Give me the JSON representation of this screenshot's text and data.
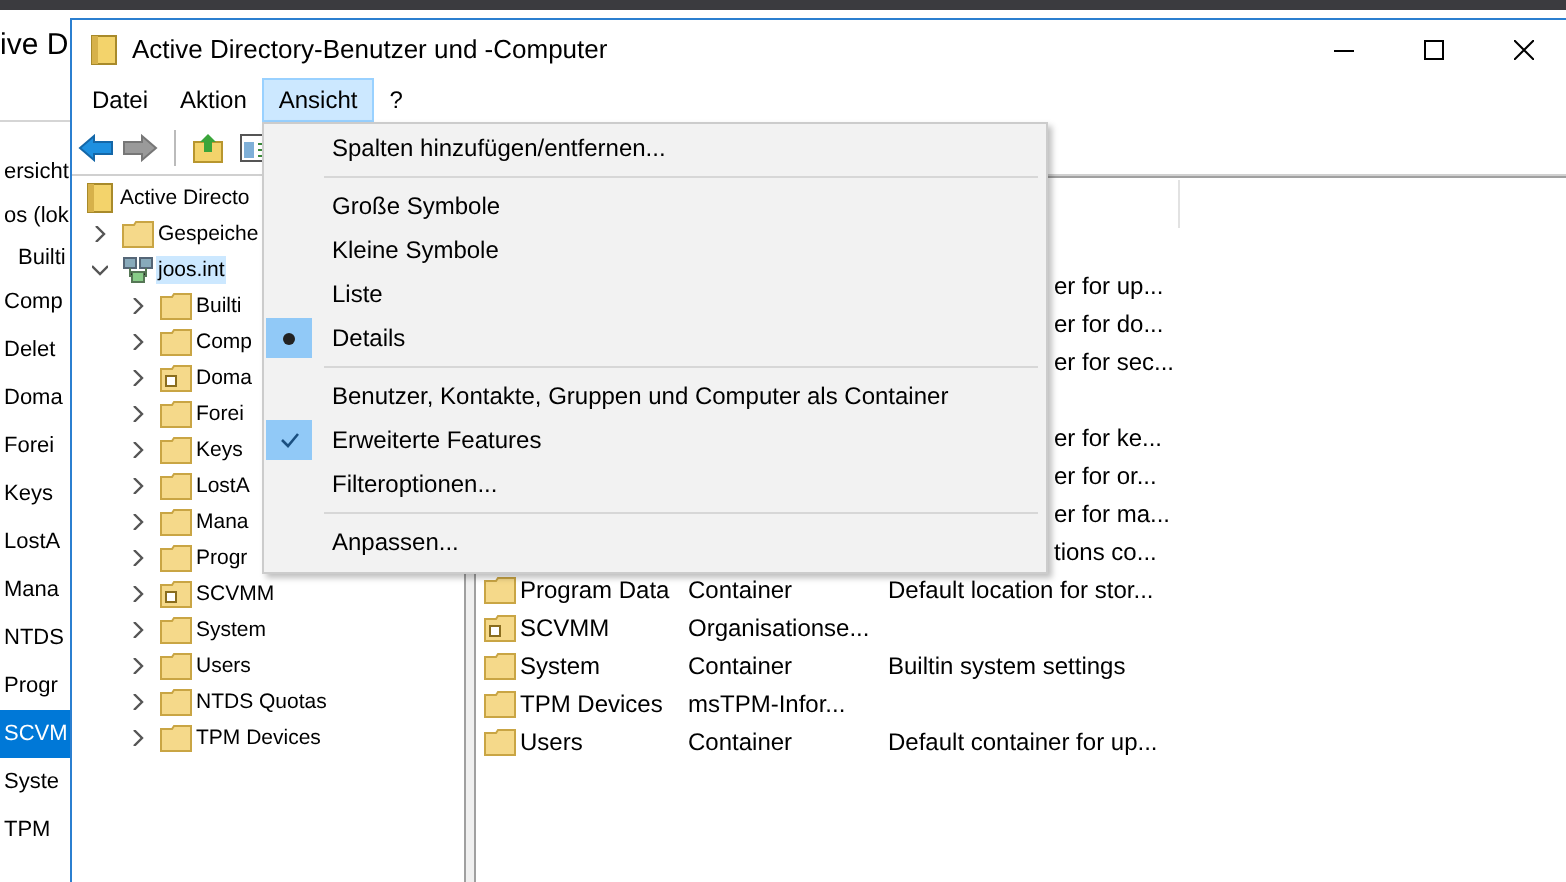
{
  "background_window": {
    "title": "ive D",
    "items": [
      {
        "label": "ersicht",
        "selected": false
      },
      {
        "label": "os (lok",
        "selected": false
      },
      {
        "label": "Builti",
        "selected": false
      },
      {
        "label": "Comp",
        "selected": false
      },
      {
        "label": "Delet",
        "selected": false
      },
      {
        "label": "Doma",
        "selected": false
      },
      {
        "label": "Forei",
        "selected": false
      },
      {
        "label": "Keys",
        "selected": false
      },
      {
        "label": "LostA",
        "selected": false
      },
      {
        "label": "Mana",
        "selected": false
      },
      {
        "label": "NTDS",
        "selected": false
      },
      {
        "label": "Progr",
        "selected": false
      },
      {
        "label": "SCVM",
        "selected": true
      },
      {
        "label": "Syste",
        "selected": false
      },
      {
        "label": "TPM",
        "selected": false
      }
    ]
  },
  "window": {
    "title": "Active Directory-Benutzer und -Computer"
  },
  "menu_bar": [
    {
      "label": "Datei",
      "selected": false
    },
    {
      "label": "Aktion",
      "selected": false
    },
    {
      "label": "Ansicht",
      "selected": true
    },
    {
      "label": "?",
      "selected": false
    }
  ],
  "tree": [
    {
      "label": "Active Directo",
      "kind": "snapin",
      "selected": false,
      "children": [
        {
          "label": "Gespeiche",
          "kind": "folder",
          "expanded": false,
          "selected": false
        },
        {
          "label": "joos.int",
          "kind": "domain",
          "expanded": true,
          "selected": true,
          "children": [
            {
              "label": "Builti",
              "kind": "folder",
              "expanded": false,
              "selected": false
            },
            {
              "label": "Comp",
              "kind": "folder",
              "expanded": false,
              "selected": false
            },
            {
              "label": "Doma",
              "kind": "ou",
              "expanded": false,
              "selected": false
            },
            {
              "label": "Forei",
              "kind": "folder",
              "expanded": false,
              "selected": false
            },
            {
              "label": "Keys",
              "kind": "folder",
              "expanded": false,
              "selected": false
            },
            {
              "label": "LostA",
              "kind": "folder",
              "expanded": false,
              "selected": false
            },
            {
              "label": "Mana",
              "kind": "folder",
              "expanded": false,
              "selected": false
            },
            {
              "label": "Progr",
              "kind": "folder",
              "expanded": false,
              "selected": false
            },
            {
              "label": "SCVMM",
              "kind": "ou",
              "expanded": false,
              "selected": false
            },
            {
              "label": "System",
              "kind": "folder",
              "expanded": false,
              "selected": false
            },
            {
              "label": "Users",
              "kind": "folder",
              "expanded": false,
              "selected": false
            },
            {
              "label": "NTDS Quotas",
              "kind": "folder",
              "expanded": false,
              "selected": false
            },
            {
              "label": "TPM Devices",
              "kind": "folder",
              "expanded": false,
              "selected": false
            }
          ]
        }
      ]
    }
  ],
  "list": {
    "rows": [
      {
        "kind": "partial",
        "column_3": "er for up..."
      },
      {
        "kind": "partial",
        "column_3": "er for do..."
      },
      {
        "kind": "partial",
        "column_3": "er for sec..."
      },
      {
        "kind": "blank"
      },
      {
        "kind": "partial",
        "column_3": "er for ke..."
      },
      {
        "kind": "partial",
        "column_3": "er for or..."
      },
      {
        "kind": "partial",
        "column_3": "er for ma..."
      },
      {
        "kind": "partial",
        "column_3": "tions co..."
      },
      {
        "kind": "folder",
        "name": "Program Data",
        "type": "Container",
        "description": "Default location for stor..."
      },
      {
        "kind": "ou",
        "name": "SCVMM",
        "type": "Organisationse..."
      },
      {
        "kind": "folder",
        "name": "System",
        "type": "Container",
        "description": "Builtin system settings"
      },
      {
        "kind": "folder",
        "name": "TPM Devices",
        "type": "msTPM-Infor..."
      },
      {
        "kind": "folder",
        "name": "Users",
        "type": "Container",
        "description": "Default container for up..."
      }
    ]
  },
  "view_menu": {
    "items": [
      {
        "kind": "command",
        "label": "Spalten hinzufügen/entfernen..."
      },
      {
        "kind": "separator"
      },
      {
        "kind": "radio",
        "label": "Große Symbole",
        "checked": false
      },
      {
        "kind": "radio",
        "label": "Kleine Symbole",
        "checked": false
      },
      {
        "kind": "radio",
        "label": "Liste",
        "checked": false
      },
      {
        "kind": "radio",
        "label": "Details",
        "checked": true
      },
      {
        "kind": "separator"
      },
      {
        "kind": "check",
        "label": "Benutzer, Kontakte, Gruppen und Computer als Container",
        "checked": false
      },
      {
        "kind": "check",
        "label": "Erweiterte Features",
        "checked": true
      },
      {
        "kind": "command",
        "label": "Filteroptionen..."
      },
      {
        "kind": "separator"
      },
      {
        "kind": "command",
        "label": "Anpassen..."
      }
    ]
  }
}
